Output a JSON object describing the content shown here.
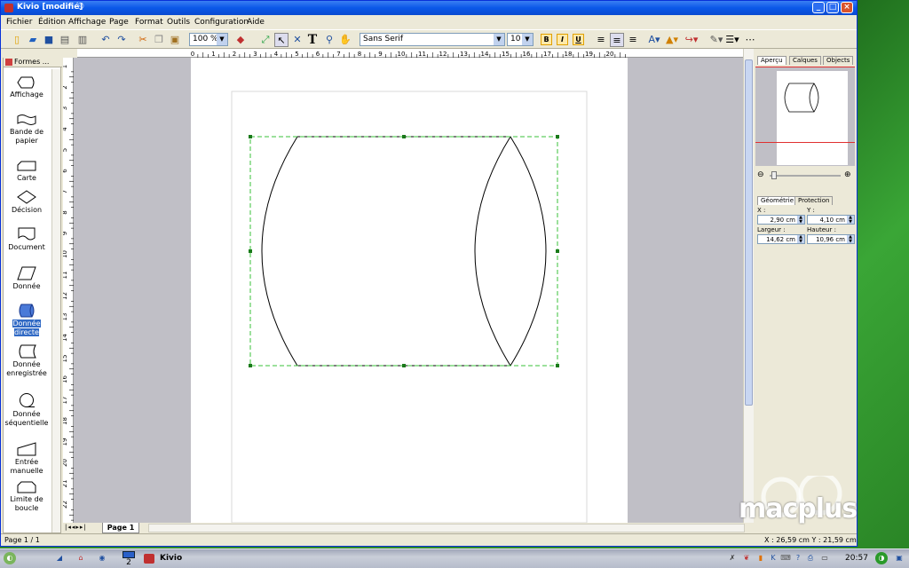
{
  "window": {
    "title": "Kivio [modifié]",
    "buttons": {
      "minimize": "_",
      "maximize": "□",
      "close": "×"
    }
  },
  "menu": [
    "Fichier",
    "Édition",
    "Affichage",
    "Page",
    "Format",
    "Outils",
    "Configuration",
    "Aide"
  ],
  "toolbar": {
    "zoom": "100 %",
    "font": "Sans Serif",
    "font_size": "10",
    "bold": "B",
    "italic": "I",
    "underline": "U",
    "text_tool": "T"
  },
  "ruler_h_labels": [
    "0",
    "1",
    "2",
    "3",
    "4",
    "5",
    "6",
    "7",
    "8",
    "9",
    "10",
    "11",
    "12",
    "13",
    "14",
    "15",
    "16",
    "17",
    "18",
    "19",
    "20"
  ],
  "ruler_v_labels": [
    "1",
    "2",
    "3",
    "4",
    "5",
    "6",
    "7",
    "8",
    "9",
    "10",
    "11",
    "12",
    "13",
    "14",
    "15",
    "16",
    "17",
    "18",
    "19",
    "20",
    "21",
    "22"
  ],
  "sidebar": {
    "tab_label": "Formes ...",
    "shapes": [
      {
        "label": "Affichage",
        "icon": "display-shape-icon"
      },
      {
        "label": "Bande de papier",
        "icon": "paper-tape-shape-icon"
      },
      {
        "label": "Carte",
        "icon": "card-shape-icon"
      },
      {
        "label": "Décision",
        "icon": "decision-shape-icon"
      },
      {
        "label": "Document",
        "icon": "document-shape-icon"
      },
      {
        "label": "Donnée",
        "icon": "data-shape-icon"
      },
      {
        "label": "Donnée directe",
        "icon": "direct-data-shape-icon"
      },
      {
        "label": "Donnée enregistrée",
        "icon": "stored-data-shape-icon"
      },
      {
        "label": "Donnée séquentielle",
        "icon": "sequential-data-shape-icon"
      },
      {
        "label": "Entrée manuelle",
        "icon": "manual-input-shape-icon"
      },
      {
        "label": "Limite de boucle",
        "icon": "loop-limit-shape-icon"
      }
    ],
    "selected": "Donnée directe"
  },
  "page_tab": "Page 1",
  "status": {
    "page": "Page 1 / 1",
    "coords": "X : 26,59 cm Y : 21,59 cm"
  },
  "right_panel": {
    "tabs": [
      "Aperçu",
      "Calques",
      "Objects"
    ],
    "geometry_tabs": [
      "Géométrie",
      "Protection"
    ],
    "x_label": "X :",
    "y_label": "Y :",
    "x_value": "2,90 cm",
    "y_value": "4,10 cm",
    "width_label": "Largeur :",
    "height_label": "Hauteur :",
    "width_value": "14,62 cm",
    "height_value": "10,96 cm"
  },
  "taskbar": {
    "desktop_number": "2",
    "app_label": "Kivio",
    "clock": "20:57"
  },
  "watermark": "macplus"
}
